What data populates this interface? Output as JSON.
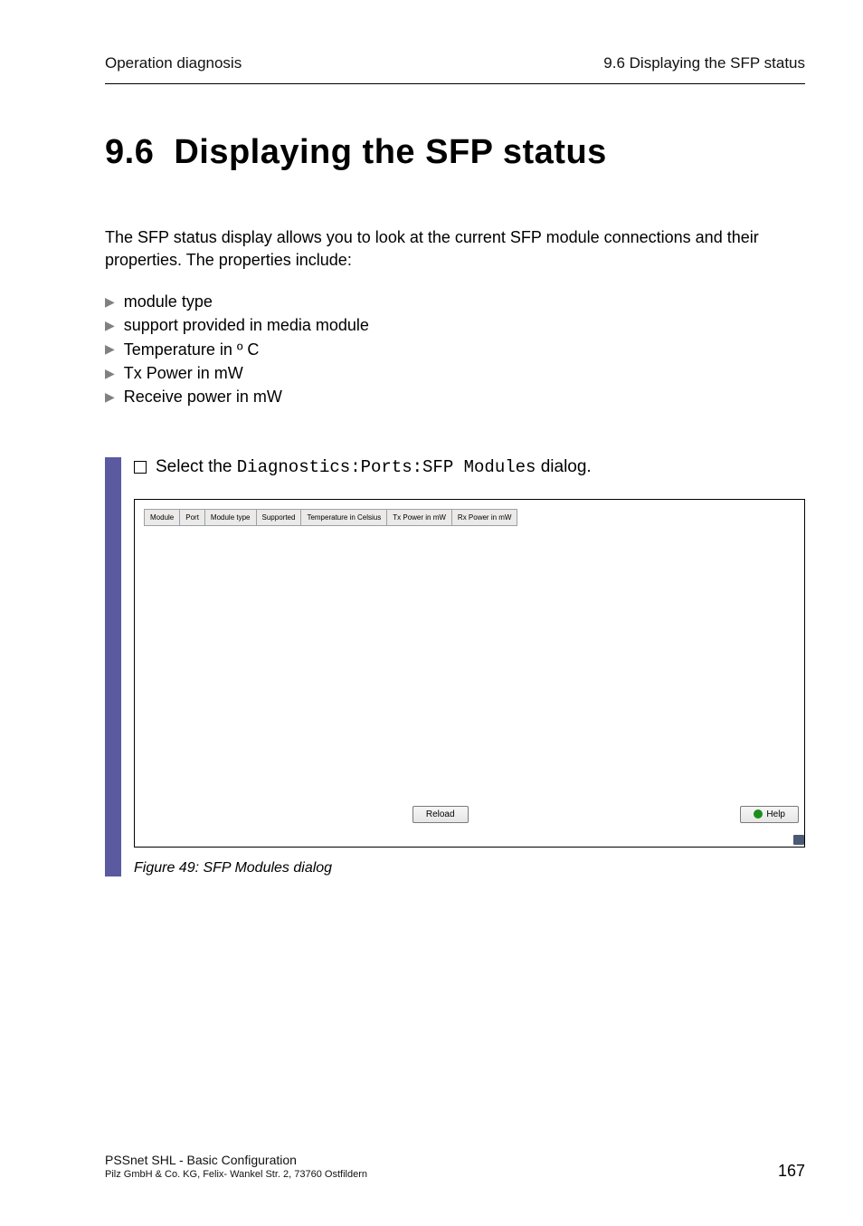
{
  "header": {
    "left": "Operation diagnosis",
    "right": "9.6  Displaying the SFP status"
  },
  "title": {
    "number": "9.6",
    "text": "Displaying the SFP status"
  },
  "intro": "The SFP status display allows you to look at the current SFP module connections and their properties. The properties include:",
  "bullets": [
    "module type",
    "support provided in media module",
    "Temperature in º C",
    "Tx Power in mW",
    "Receive power in mW"
  ],
  "step": {
    "prefix": "Select the ",
    "path": "Diagnostics:Ports:SFP Modules",
    "suffix": " dialog."
  },
  "table": {
    "columns": [
      "Module",
      "Port",
      "Module type",
      "Supported",
      "Temperature in Celsius",
      "Tx Power in mW",
      "Rx Power in mW"
    ]
  },
  "buttons": {
    "reload": "Reload",
    "help": "Help"
  },
  "caption": "Figure 49: SFP Modules dialog",
  "footer": {
    "line1": "PSSnet SHL - Basic Configuration",
    "line2": "Pilz GmbH & Co. KG, Felix- Wankel Str. 2, 73760 Ostfildern",
    "page": "167"
  }
}
